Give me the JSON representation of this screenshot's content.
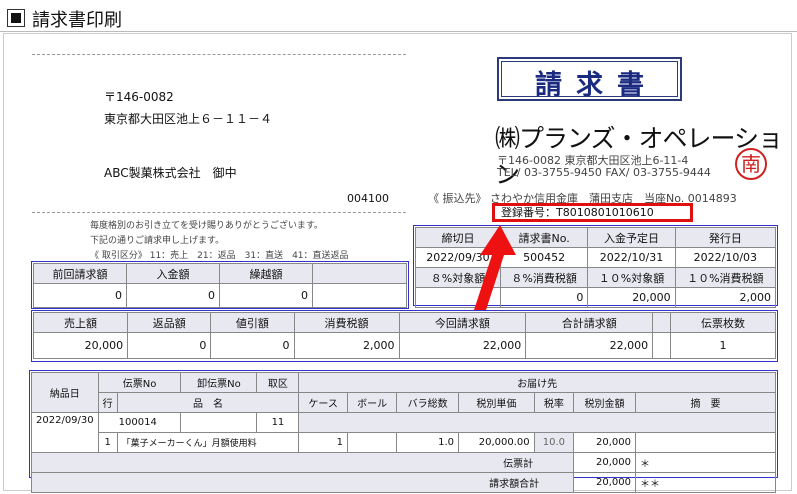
{
  "header": {
    "title": "請求書印刷"
  },
  "invoice": {
    "doc_title": "請求書",
    "recipient": {
      "postal": "〒146-0082",
      "address": "東京都大田区池上６－１１－４",
      "name": "ABC製菓株式会社　御中",
      "code": "004100"
    },
    "notes": {
      "line1": "毎度格別のお引き立てを受け賜りありがとうございます。",
      "line2": "下記の通りご請求申し上げます。",
      "line3": "《 取引区分》 11：売上　21：返品　31：直送　41：直送返品"
    },
    "company": {
      "name": "㈱プランズ・オペレーション",
      "address": "〒146-0082 東京都大田区池上6-11-4",
      "tel_fax": "TEL/ 03-3755-9450 FAX/ 03-3755-9444",
      "stamp": "南"
    },
    "bank": "《 振込先》 さわやか信用金庫　蒲田支店　当座No. 0014893",
    "registration": "登録番号：T8010801010610",
    "info_table": {
      "headers": [
        "締切日",
        "請求書No.",
        "入金予定日",
        "発行日"
      ],
      "values": [
        "2022/09/30",
        "500452",
        "2022/10/31",
        "2022/10/03"
      ],
      "tax_headers": [
        "８%対象額",
        "８%消費税額",
        "１０%対象額",
        "１０%消費税額"
      ],
      "tax_values": [
        "",
        "0",
        "20,000",
        "2,000"
      ]
    },
    "prev_table": {
      "headers": [
        "前回請求額",
        "入金額",
        "繰越額",
        ""
      ],
      "values": [
        "0",
        "0",
        "0",
        ""
      ]
    },
    "summary_table": {
      "headers": [
        "売上額",
        "返品額",
        "値引額",
        "消費税額",
        "今回請求額",
        "合計請求額",
        "",
        "伝票枚数"
      ],
      "values": [
        "20,000",
        "0",
        "0",
        "2,000",
        "22,000",
        "22,000",
        "",
        "1"
      ]
    },
    "detail": {
      "h_date": "納品日",
      "h_slip": "伝票No",
      "h_wslip": "卸伝票No",
      "h_kubun": "取区",
      "h_dest": "お届け先",
      "h_row": "行",
      "h_item": "品　名",
      "h_case": "ケース",
      "h_ball": "ボール",
      "h_bara": "バラ総数",
      "h_price": "税別単価",
      "h_rate": "税率",
      "h_amount": "税別金額",
      "h_remark": "摘　要",
      "date": "2022/09/30",
      "slip": "100014",
      "kubun": "11",
      "line_no": "1",
      "item": "「菓子メーカーくん」月額使用料",
      "case": "1",
      "bara": "1.0",
      "price": "20,000.00",
      "rate": "10.0",
      "amount": "20,000",
      "slip_total_label": "伝票計",
      "slip_total": "20,000",
      "slip_total_mark": "＊",
      "grand_total_label": "請求額合計",
      "grand_total": "20,000",
      "grand_total_mark": "＊＊"
    }
  }
}
